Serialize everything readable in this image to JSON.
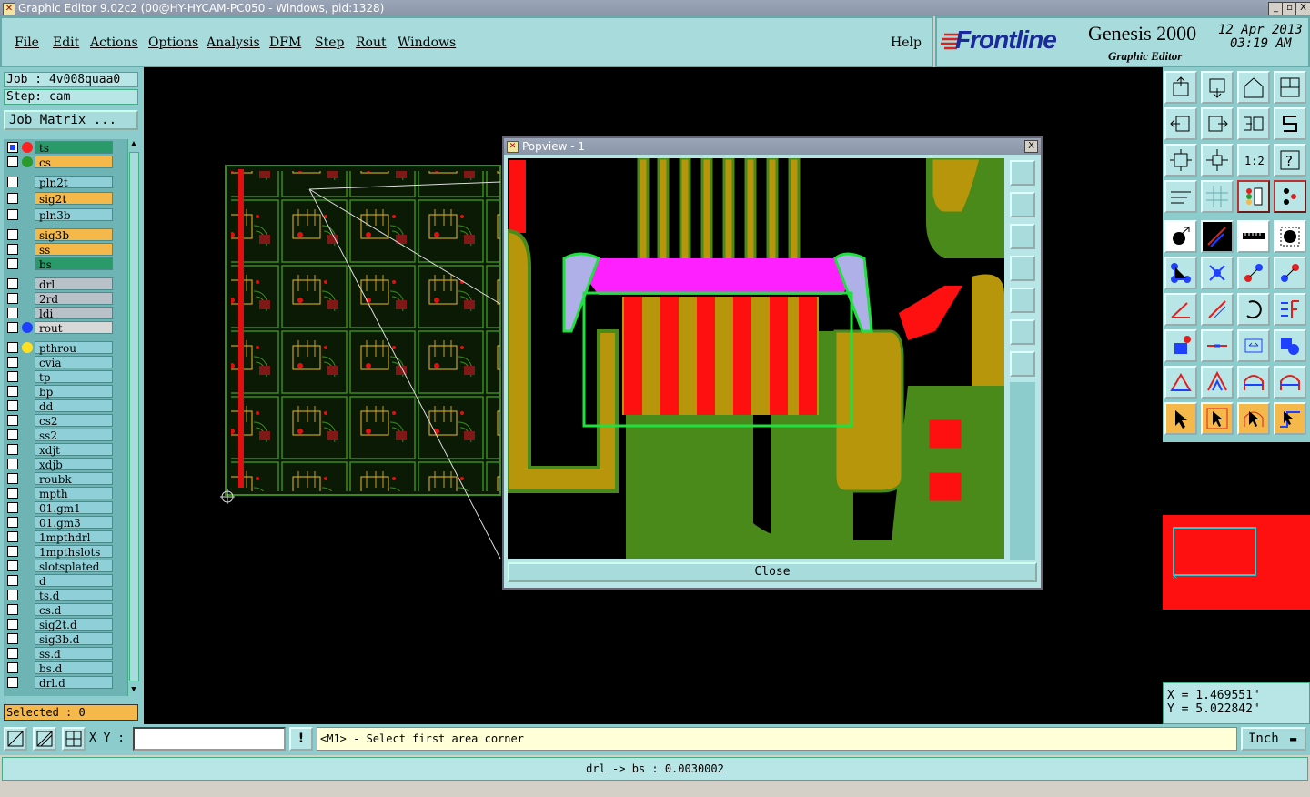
{
  "window": {
    "title": "Graphic Editor 9.02c2 (00@HY-HYCAM-PC050 - Windows, pid:1328)",
    "min": "_",
    "max": "▫",
    "close": "X"
  },
  "menu": {
    "items": [
      "File",
      "Edit",
      "Actions",
      "Options",
      "Analysis",
      "DFM",
      "Step",
      "Rout",
      "Windows"
    ],
    "help": "Help"
  },
  "brand": {
    "logo": "Frontline",
    "product": "Genesis 2000",
    "subtitle": "Graphic Editor",
    "date": "12 Apr 2013",
    "time": "03:19 AM"
  },
  "job": {
    "job_label": "Job : 4v008quaa0",
    "step_label": "Step: cam",
    "matrix_button": "Job Matrix ..."
  },
  "layers": [
    {
      "name": "ts",
      "bg": "#2a9a6a",
      "dot": "#ff2020",
      "sel": true
    },
    {
      "name": "cs",
      "bg": "#f5b84a",
      "dot": "#2a9a2a"
    },
    {
      "name": "pln2t",
      "bg": "#8fd0d8"
    },
    {
      "name": "sig2t",
      "bg": "#f5b84a"
    },
    {
      "name": "pln3b",
      "bg": "#8fd0d8"
    },
    {
      "name": "sig3b",
      "bg": "#f5b84a"
    },
    {
      "name": "ss",
      "bg": "#f5b84a"
    },
    {
      "name": "bs",
      "bg": "#2a9a6a"
    },
    {
      "name": "drl",
      "bg": "#b8c0c8"
    },
    {
      "name": "2rd",
      "bg": "#b8c0c8"
    },
    {
      "name": "ldi",
      "bg": "#b8c0c8"
    },
    {
      "name": "rout",
      "bg": "#d8d8d8",
      "dot": "#2040ff"
    },
    {
      "name": "pthrou",
      "bg": "#8fd0d8",
      "dot": "#ffe020"
    },
    {
      "name": "cvia",
      "bg": "#8fd0d8"
    },
    {
      "name": "tp",
      "bg": "#8fd0d8"
    },
    {
      "name": "bp",
      "bg": "#8fd0d8"
    },
    {
      "name": "dd",
      "bg": "#8fd0d8"
    },
    {
      "name": "cs2",
      "bg": "#8fd0d8"
    },
    {
      "name": "ss2",
      "bg": "#8fd0d8"
    },
    {
      "name": "xdjt",
      "bg": "#8fd0d8"
    },
    {
      "name": "xdjb",
      "bg": "#8fd0d8"
    },
    {
      "name": "roubk",
      "bg": "#8fd0d8"
    },
    {
      "name": "mpth",
      "bg": "#8fd0d8"
    },
    {
      "name": "01.gm1",
      "bg": "#8fd0d8"
    },
    {
      "name": "01.gm3",
      "bg": "#8fd0d8"
    },
    {
      "name": "1mpthdrl",
      "bg": "#8fd0d8"
    },
    {
      "name": "1mpthslots",
      "bg": "#8fd0d8"
    },
    {
      "name": "slotsplated",
      "bg": "#8fd0d8"
    },
    {
      "name": "d",
      "bg": "#8fd0d8"
    },
    {
      "name": "ts.d",
      "bg": "#8fd0d8"
    },
    {
      "name": "cs.d",
      "bg": "#8fd0d8"
    },
    {
      "name": "sig2t.d",
      "bg": "#8fd0d8"
    },
    {
      "name": "sig3b.d",
      "bg": "#8fd0d8"
    },
    {
      "name": "ss.d",
      "bg": "#8fd0d8"
    },
    {
      "name": "bs.d",
      "bg": "#8fd0d8"
    },
    {
      "name": "drl.d",
      "bg": "#8fd0d8"
    }
  ],
  "selected": "Selected : 0",
  "popview": {
    "title": "Popview - 1",
    "close_label": "Close",
    "close_x": "X"
  },
  "coords": {
    "x": "X = 1.469551\"",
    "y": "Y = 5.022842\""
  },
  "bottom": {
    "xy_label": "X Y :",
    "xy_value": "",
    "alert": "!",
    "prompt": "<M1> - Select first area corner",
    "unit": "Inch"
  },
  "status": "drl -> bs : 0.0030002",
  "colors": {
    "panel": "#8ccccc",
    "accent_orange": "#f5b84a",
    "copper_green": "#4a8a1a",
    "gold": "#b8960c",
    "pad_red": "#ff1010"
  }
}
